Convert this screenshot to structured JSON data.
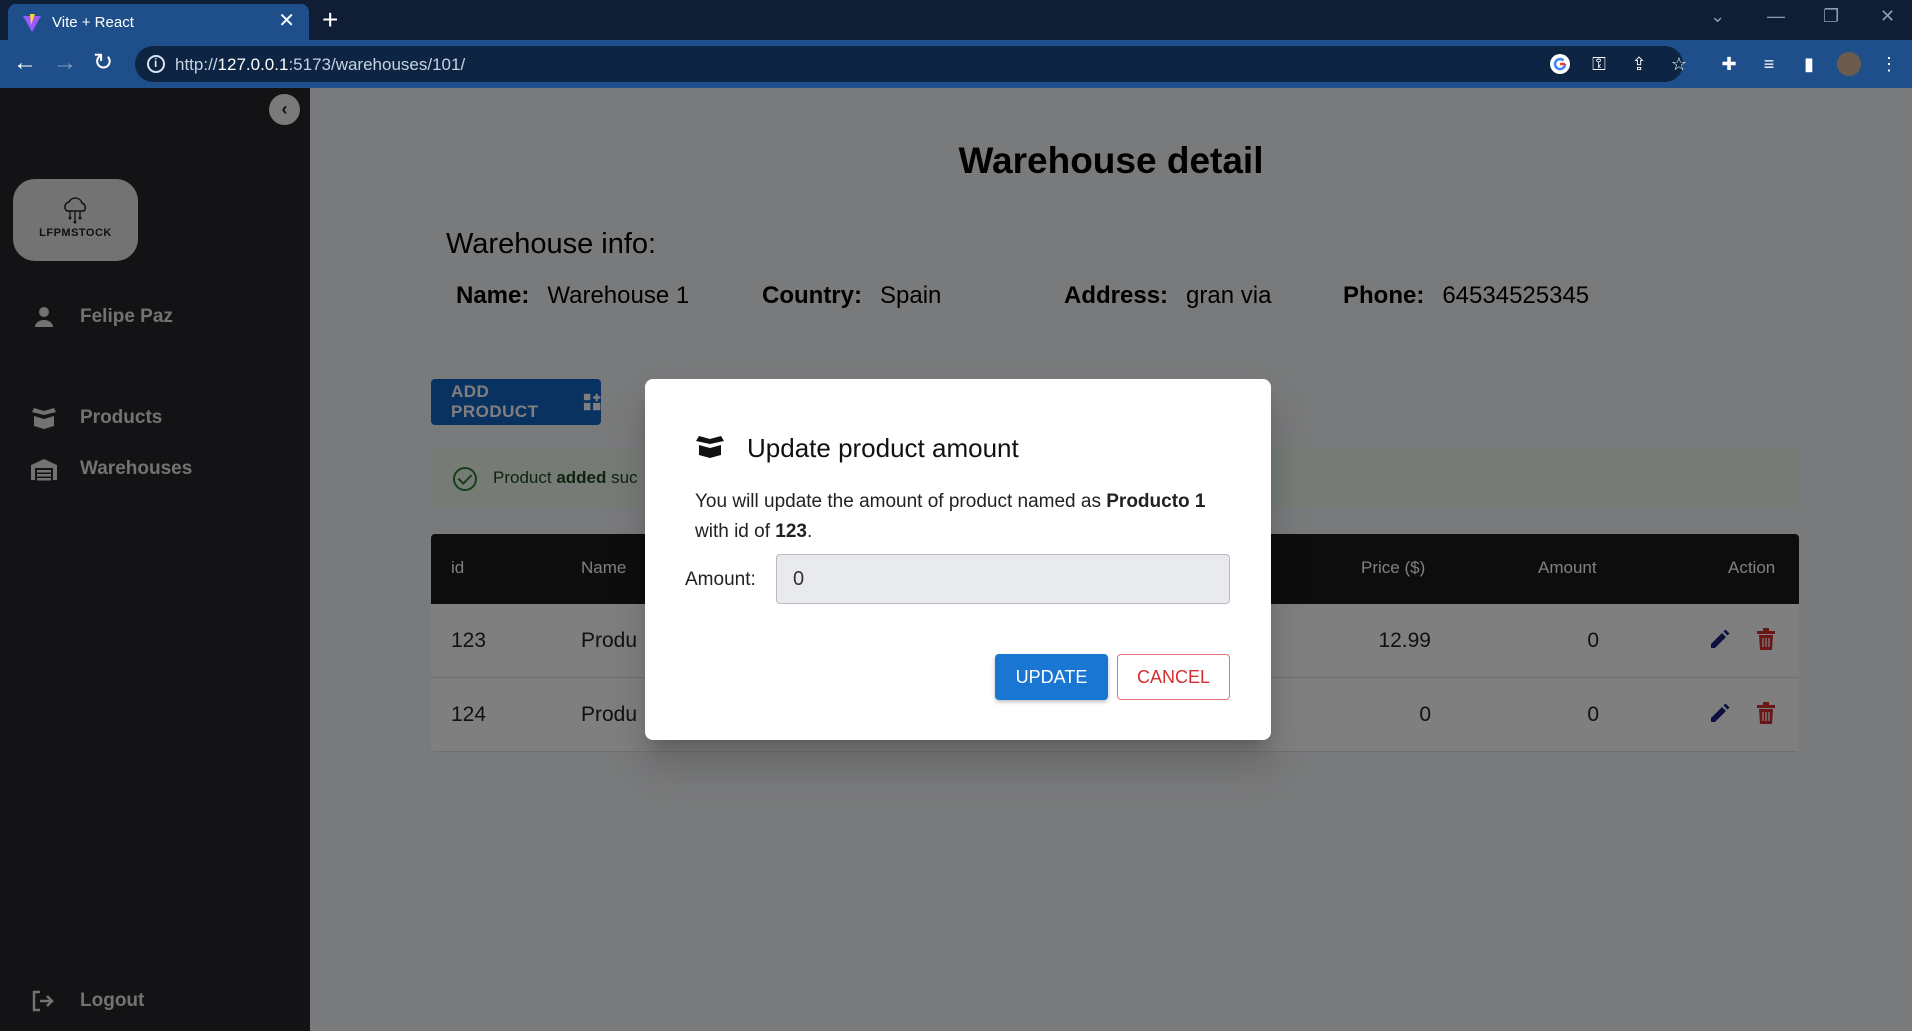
{
  "browser": {
    "tab_title": "Vite + React",
    "url_host": "127.0.0.1",
    "url_prefix": "http://",
    "url_suffix": ":5173/warehouses/101/"
  },
  "sidebar": {
    "logo_text": "LFPMSTOCK",
    "user_name": "Felipe Paz",
    "items": [
      {
        "label": "Products",
        "icon": "box-open-icon"
      },
      {
        "label": "Warehouses",
        "icon": "warehouse-icon"
      }
    ],
    "logout_label": "Logout"
  },
  "page": {
    "title": "Warehouse detail",
    "info_heading": "Warehouse info:",
    "info": {
      "name_label": "Name:",
      "name_value": "Warehouse 1",
      "country_label": "Country:",
      "country_value": "Spain",
      "address_label": "Address:",
      "address_value": "gran via",
      "phone_label": "Phone:",
      "phone_value": "64534525345"
    },
    "add_button_label": "ADD PRODUCT",
    "alert": {
      "prefix": "Product ",
      "bold": "added",
      "suffix": " suc"
    }
  },
  "table": {
    "headers": {
      "id": "id",
      "name": "Name",
      "price": "Price ($)",
      "amount": "Amount",
      "action": "Action"
    },
    "rows": [
      {
        "id": "123",
        "name": "Produ",
        "price": "12.99",
        "amount": "0"
      },
      {
        "id": "124",
        "name": "Produ",
        "price": "0",
        "amount": "0"
      }
    ]
  },
  "dialog": {
    "title": "Update product amount",
    "msg_prefix": "You will update the amount of product named as ",
    "product_name": "Producto 1",
    "msg_mid": " with id of ",
    "product_id": "123",
    "msg_end": ".",
    "amount_label": "Amount:",
    "amount_value": "0",
    "update_label": "UPDATE",
    "cancel_label": "CANCEL"
  },
  "colors": {
    "primary": "#1565c0",
    "danger": "#d32f2f",
    "success": "#2e7d32",
    "sidebar_bg": "#27272a"
  }
}
